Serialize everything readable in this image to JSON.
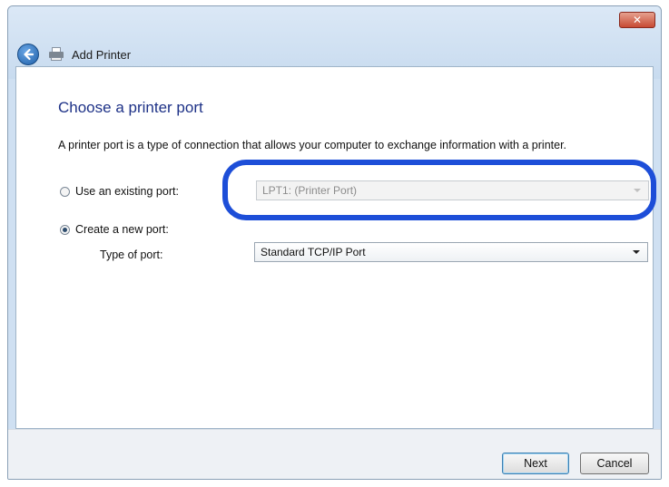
{
  "window": {
    "close_glyph": "✕"
  },
  "nav": {
    "title": "Add Printer",
    "back_icon": "back-arrow-icon",
    "printer_icon": "printer-icon"
  },
  "page": {
    "heading": "Choose a printer port",
    "description": "A printer port is a type of connection that allows your computer to exchange information with a printer."
  },
  "options": {
    "existing": {
      "label": "Use an existing port:",
      "selected": false,
      "value": "LPT1: (Printer Port)"
    },
    "create": {
      "label": "Create a new port:",
      "selected": true
    },
    "type_label": "Type of port:",
    "type_value": "Standard TCP/IP Port"
  },
  "buttons": {
    "next": "Next",
    "cancel": "Cancel"
  },
  "colors": {
    "highlight": "#1d4ed8",
    "heading": "#1e3287"
  }
}
